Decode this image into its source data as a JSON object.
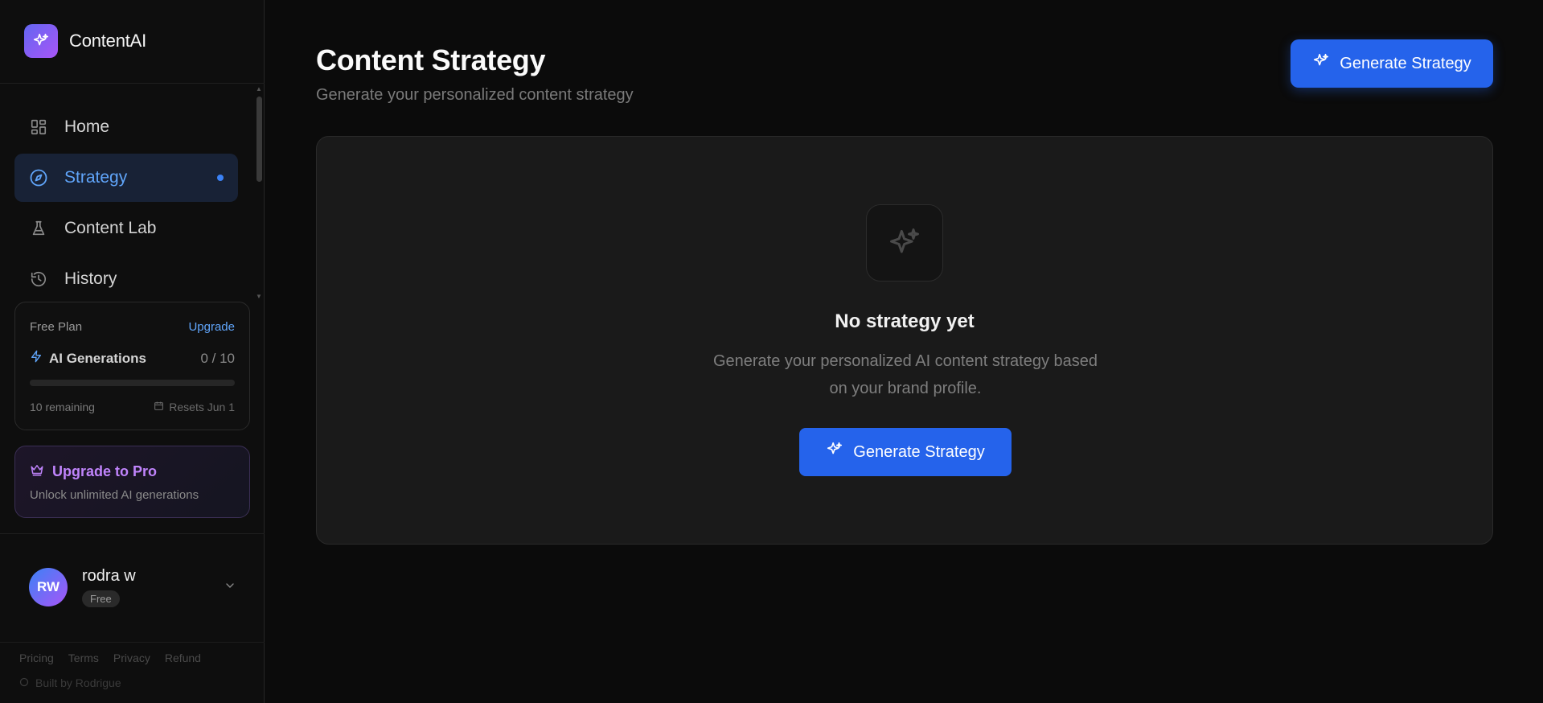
{
  "brand": {
    "name": "ContentAI",
    "logo_icon": "sparkle-icon"
  },
  "nav": {
    "items": [
      {
        "label": "Home",
        "icon": "grid-icon",
        "active": false
      },
      {
        "label": "Strategy",
        "icon": "compass-icon",
        "active": true
      },
      {
        "label": "Content Lab",
        "icon": "flask-icon",
        "active": false
      },
      {
        "label": "History",
        "icon": "history-icon",
        "active": false
      }
    ]
  },
  "plan": {
    "label": "Free Plan",
    "upgrade_link": "Upgrade",
    "generations_label": "AI Generations",
    "generations_count": "0 / 10",
    "progress_fraction": 0,
    "remaining": "10 remaining",
    "resets": "Resets Jun 1"
  },
  "pro": {
    "title": "Upgrade to Pro",
    "subtitle": "Unlock unlimited AI generations"
  },
  "user": {
    "initials": "RW",
    "name": "rodra w",
    "badge": "Free"
  },
  "footer": {
    "links": [
      "Pricing",
      "Terms",
      "Privacy",
      "Refund"
    ],
    "built_by": "Built by Rodrigue"
  },
  "page": {
    "title": "Content Strategy",
    "subtitle": "Generate your personalized content strategy",
    "primary_button": "Generate Strategy"
  },
  "empty_state": {
    "title": "No strategy yet",
    "description": "Generate your personalized AI content strategy based on your brand profile.",
    "button": "Generate Strategy"
  },
  "colors": {
    "accent": "#2563eb",
    "active_nav_text": "#60a5fa",
    "pro_accent": "#c084fc",
    "background": "#0b0b0b"
  }
}
